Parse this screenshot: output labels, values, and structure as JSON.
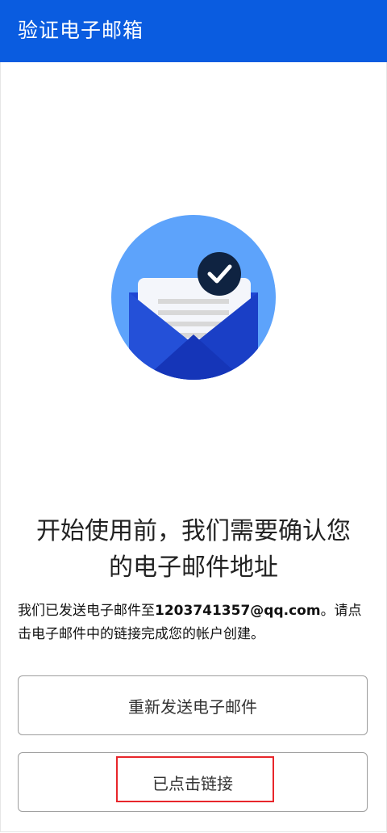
{
  "app_bar": {
    "title": "验证电子邮箱"
  },
  "illustration": {
    "icon": "email-verified-envelope-icon",
    "circle_color": "#5da3fb",
    "envelope_color": "#1f46d3",
    "check_badge_color": "#0f2341"
  },
  "main": {
    "headline_line1": "开始使用前，我们需要确认您",
    "headline_line2": "的电子邮件地址",
    "body_prefix": "我们已发送电子邮件至",
    "email": "1203741357@qq.com",
    "body_suffix": "。请点击电子邮件中的链接完成您的帐户创建。"
  },
  "buttons": {
    "resend_label": "重新发送电子邮件",
    "clicked_label": "已点击链接"
  },
  "colors": {
    "app_bar": "#0a5ce0",
    "highlight": "#e8262b"
  }
}
